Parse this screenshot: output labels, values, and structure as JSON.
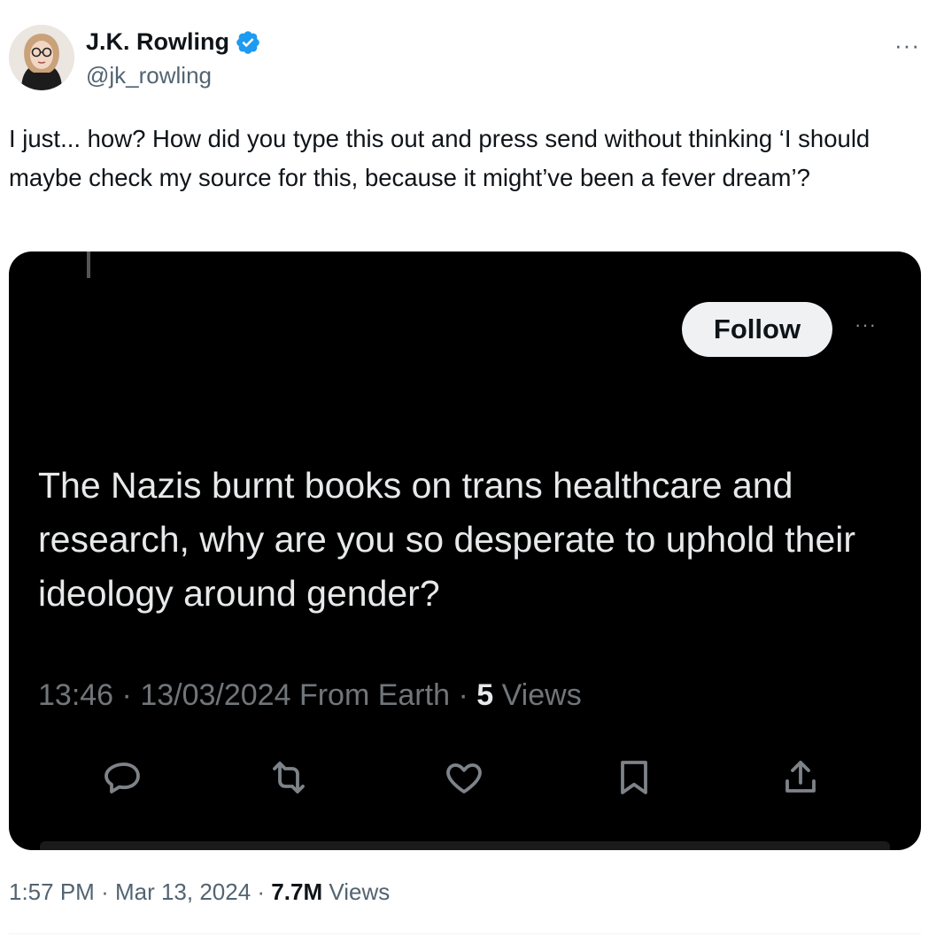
{
  "author": {
    "display_name": "J.K. Rowling",
    "handle": "@jk_rowling",
    "verified_icon": "verified-badge-icon",
    "verified_color": "#1d9bf0",
    "more_label": "···"
  },
  "tweet": {
    "text": "I just... how? How did you type this out and press send without thinking ‘I should maybe check my source for this, because it might’ve been a fever dream’?"
  },
  "quoted_screenshot": {
    "follow_label": "Follow",
    "more_label": "···",
    "text": "The Nazis burnt books on trans healthcare and research, why are you so desperate to uphold their ideology around gender?",
    "time": "13:46",
    "date": "13/03/2024",
    "location": "From Earth",
    "views_count": "5",
    "views_label": "Views",
    "actions": [
      "reply-icon",
      "retweet-icon",
      "like-icon",
      "bookmark-icon",
      "share-icon"
    ],
    "background": "#000000"
  },
  "footer": {
    "time": "1:57 PM",
    "date": "Mar 13, 2024",
    "views_count": "7.7M",
    "views_label": "Views"
  }
}
